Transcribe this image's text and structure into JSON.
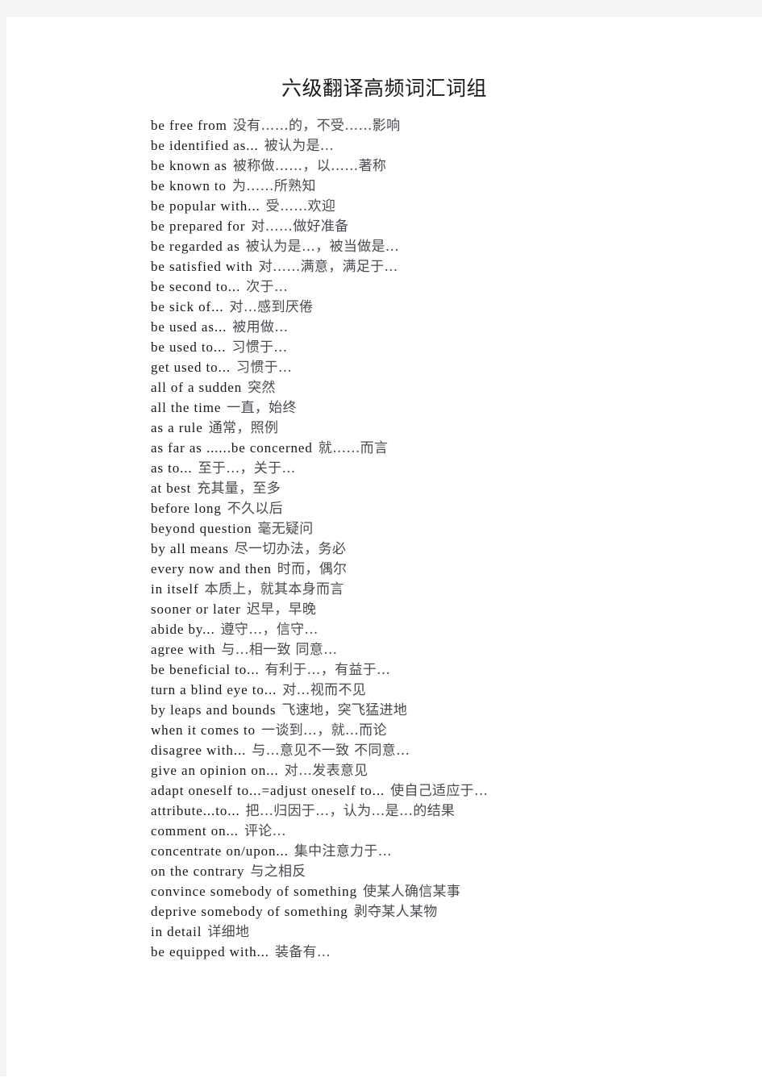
{
  "document": {
    "title": "六级翻译高频词汇词组",
    "entries": [
      {
        "en": "be free from",
        "zh": "没有……的，不受……影响"
      },
      {
        "en": "be identified as...",
        "zh": "被认为是…"
      },
      {
        "en": "be known as",
        "zh": "被称做……，以……著称"
      },
      {
        "en": "be known to",
        "zh": "为……所熟知"
      },
      {
        "en": "be popular with...",
        "zh": "受……欢迎"
      },
      {
        "en": "be prepared for",
        "zh": "对……做好准备"
      },
      {
        "en": "be regarded as",
        "zh": "被认为是…，被当做是…"
      },
      {
        "en": "be satisfied with",
        "zh": "对……满意，满足于…"
      },
      {
        "en": "be second to...",
        "zh": "次于…"
      },
      {
        "en": "be sick of...",
        "zh": "对…感到厌倦"
      },
      {
        "en": "be used as...",
        "zh": "被用做…"
      },
      {
        "en": "be used to...",
        "zh": "习惯于…"
      },
      {
        "en": "get used to...",
        "zh": "习惯于…"
      },
      {
        "en": "all of a sudden",
        "zh": "突然"
      },
      {
        "en": "all the time",
        "zh": "一直，始终"
      },
      {
        "en": "as a rule",
        "zh": "通常，照例"
      },
      {
        "en": "as far as ......be concerned",
        "zh": "就……而言"
      },
      {
        "en": "as to...",
        "zh": "至于…，关于…"
      },
      {
        "en": "at best",
        "zh": "充其量，至多"
      },
      {
        "en": "before long",
        "zh": "不久以后"
      },
      {
        "en": "beyond question",
        "zh": "毫无疑问"
      },
      {
        "en": "by all means",
        "zh": "尽一切办法，务必"
      },
      {
        "en": "every now and then",
        "zh": "时而，偶尔"
      },
      {
        "en": "in itself",
        "zh": "本质上，就其本身而言"
      },
      {
        "en": "sooner or later",
        "zh": "迟早，早晚"
      },
      {
        "en": "abide by...",
        "zh": "遵守…，信守…"
      },
      {
        "en": "agree with",
        "zh": "与…相一致 同意…"
      },
      {
        "en": "be beneficial to...",
        "zh": "有利于…，有益于…"
      },
      {
        "en": "turn a blind eye to...",
        "zh": "对…视而不见"
      },
      {
        "en": "by leaps and bounds",
        "zh": "飞速地，突飞猛进地"
      },
      {
        "en": "when it comes to",
        "zh": "一谈到…，就…而论"
      },
      {
        "en": "disagree with...",
        "zh": "与…意见不一致 不同意…"
      },
      {
        "en": "give an opinion on...",
        "zh": "对…发表意见"
      },
      {
        "en": "adapt oneself to...=adjust oneself to...",
        "zh": "使自己适应于…"
      },
      {
        "en": "attribute...to...",
        "zh": "把…归因于…，认为…是…的结果"
      },
      {
        "en": "comment on...",
        "zh": "评论…"
      },
      {
        "en": "concentrate on/upon...",
        "zh": "集中注意力于…"
      },
      {
        "en": "on the contrary",
        "zh": "与之相反"
      },
      {
        "en": "convince somebody of something",
        "zh": "使某人确信某事"
      },
      {
        "en": "deprive somebody of something",
        "zh": "剥夺某人某物"
      },
      {
        "en": "in detail",
        "zh": "详细地"
      },
      {
        "en": "be equipped with...",
        "zh": "装备有…"
      }
    ]
  }
}
